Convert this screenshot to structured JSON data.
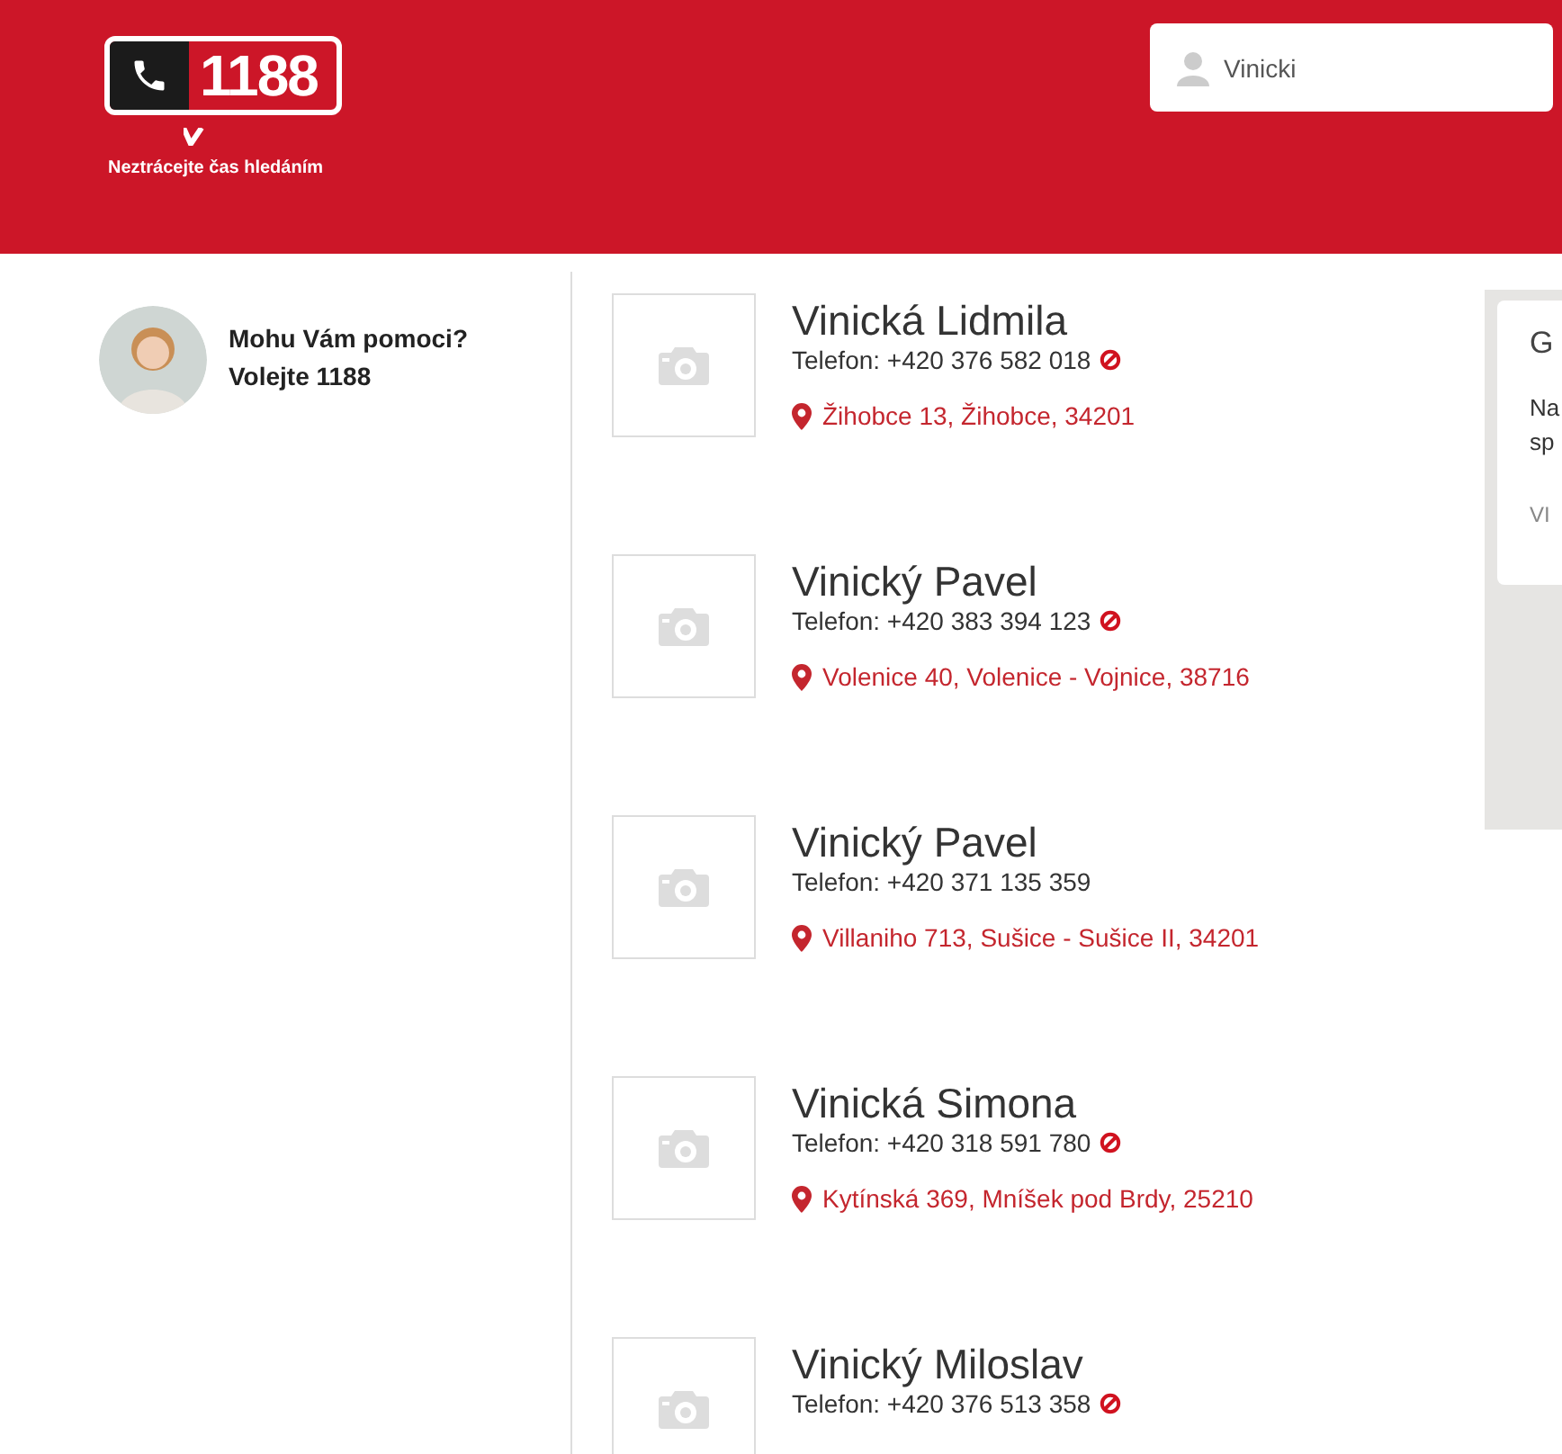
{
  "header": {
    "logo": {
      "number": "1188",
      "tagline": "Neztrácejte čas hledáním"
    },
    "search": {
      "value": "Vinicki"
    }
  },
  "help": {
    "line_1": "Mohu Vám pomoci?",
    "line_2": "Volejte 1188"
  },
  "results": [
    {
      "name": "Vinická Lidmila",
      "phone": "Telefon: +420 376 582 018",
      "blocked": true,
      "address": "Žihobce 13, Žihobce, 34201"
    },
    {
      "name": "Vinický Pavel",
      "phone": "Telefon: +420 383 394 123",
      "blocked": true,
      "address": "Volenice 40, Volenice - Vojnice, 38716"
    },
    {
      "name": "Vinický Pavel",
      "phone": "Telefon: +420 371 135 359",
      "blocked": false,
      "address": "Villaniho 713, Sušice - Sušice II, 34201"
    },
    {
      "name": "Vinická Simona",
      "phone": "Telefon: +420 318 591 780",
      "blocked": true,
      "address": "Kytínská 369, Mníšek pod Brdy, 25210"
    },
    {
      "name": "Vinický Miloslav",
      "phone": "Telefon: +420 376 513 358",
      "blocked": true
    }
  ],
  "side_card": {
    "title": "G",
    "lines": [
      "Na",
      "sp"
    ],
    "link": "VI"
  }
}
